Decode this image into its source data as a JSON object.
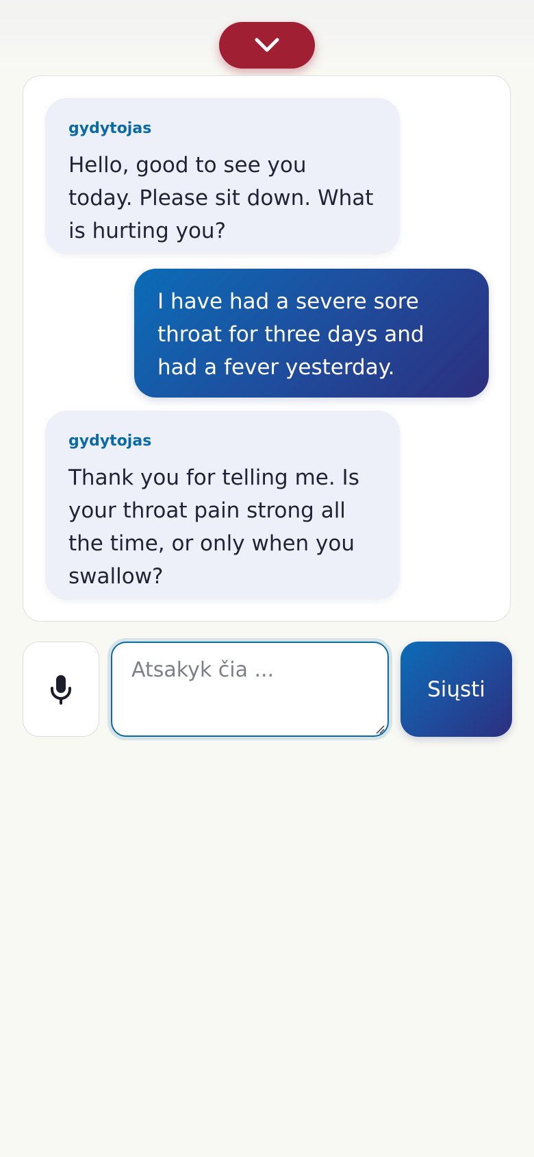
{
  "header": {
    "collapse_icon": "chevron-down-icon",
    "accent_color": "#a01f33"
  },
  "chat": {
    "messages": [
      {
        "role": "doctor",
        "sender": "gydytojas",
        "text": "Hello, good to see you today. Please sit down. What is hurting you?"
      },
      {
        "role": "user",
        "text": "I have had a severe sore throat for three days and had a fever yesterday."
      },
      {
        "role": "doctor",
        "sender": "gydytojas",
        "text": "Thank you for telling me. Is your throat pain strong all the time, or only when you swallow?"
      }
    ]
  },
  "composer": {
    "mic_icon": "microphone-icon",
    "placeholder": "Atsakyk čia ...",
    "value": "",
    "send_label": "Siųsti"
  },
  "colors": {
    "sender_label": "#0b6aa6",
    "doctor_bubble": "#edf0f9",
    "user_bubble_start": "#0b6cb7",
    "user_bubble_end": "#2d2f7f",
    "page_background": "#f9f9f4"
  }
}
